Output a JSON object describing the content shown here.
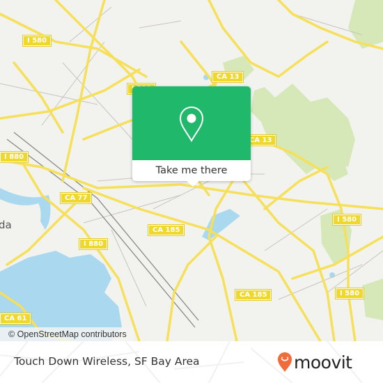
{
  "map": {
    "road_labels": [
      {
        "id": "i580-nw",
        "text": "I 580"
      },
      {
        "id": "i580-n",
        "text": "I 580"
      },
      {
        "id": "ca13-n",
        "text": "CA 13"
      },
      {
        "id": "ca13-e",
        "text": "CA 13"
      },
      {
        "id": "i880-w",
        "text": "I 880"
      },
      {
        "id": "ca77",
        "text": "CA 77"
      },
      {
        "id": "ca185-c",
        "text": "CA 185"
      },
      {
        "id": "i880-s",
        "text": "I 880"
      },
      {
        "id": "ca185-se",
        "text": "CA 185"
      },
      {
        "id": "i580-e",
        "text": "I 580"
      },
      {
        "id": "i580-se",
        "text": "I 580"
      },
      {
        "id": "ca61",
        "text": "CA 61"
      }
    ],
    "place_label": "da",
    "attribution": "© OpenStreetMap contributors",
    "colors": {
      "land": "#f2f2ef",
      "water": "#a9d8ef",
      "park": "#d6e8b8",
      "highway": "#f6e05a",
      "minor_road": "#c8c4bc"
    }
  },
  "popup": {
    "icon": "map-pin-icon",
    "button_label": "Take me there",
    "color": "#20b86a"
  },
  "footer": {
    "title": "Touch Down Wireless, SF Bay Area",
    "brand": "moovit",
    "brand_color": "#f26b3a"
  }
}
